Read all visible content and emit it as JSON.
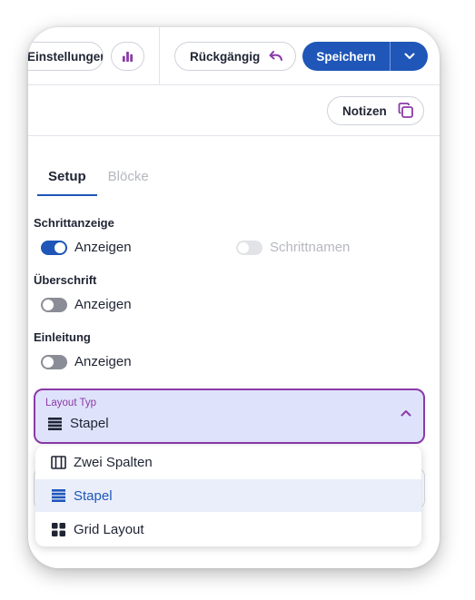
{
  "toolbar": {
    "settings_label": "Einstellungen",
    "undo_label": "Rückgängig",
    "save_label": "Speichern",
    "notes_label": "Notizen"
  },
  "tabs": [
    {
      "label": "Setup",
      "active": true
    },
    {
      "label": "Blöcke",
      "active": false
    }
  ],
  "sections": {
    "step_display": {
      "title": "Schrittanzeige",
      "show_label": "Anzeigen",
      "show_on": true,
      "step_names_label": "Schrittnamen",
      "step_names_on": false
    },
    "heading": {
      "title": "Überschrift",
      "show_label": "Anzeigen",
      "show_on": false
    },
    "intro": {
      "title": "Einleitung",
      "show_label": "Anzeigen",
      "show_on": false
    }
  },
  "layout_select": {
    "label": "Layout Typ",
    "value": "Stapel",
    "value_icon": "stack-icon",
    "open": true,
    "options": [
      {
        "label": "Zwei Spalten",
        "icon": "two-columns-icon",
        "selected": false
      },
      {
        "label": "Stapel",
        "icon": "stack-icon",
        "selected": true
      },
      {
        "label": "Grid Layout",
        "icon": "grid-icon",
        "selected": false
      }
    ]
  },
  "colors": {
    "primary": "#1f56b8",
    "accent_purple": "#8a3aa6",
    "select_bg": "#dfe2fb",
    "text": "#1f2433",
    "muted": "#b6b8c0"
  }
}
